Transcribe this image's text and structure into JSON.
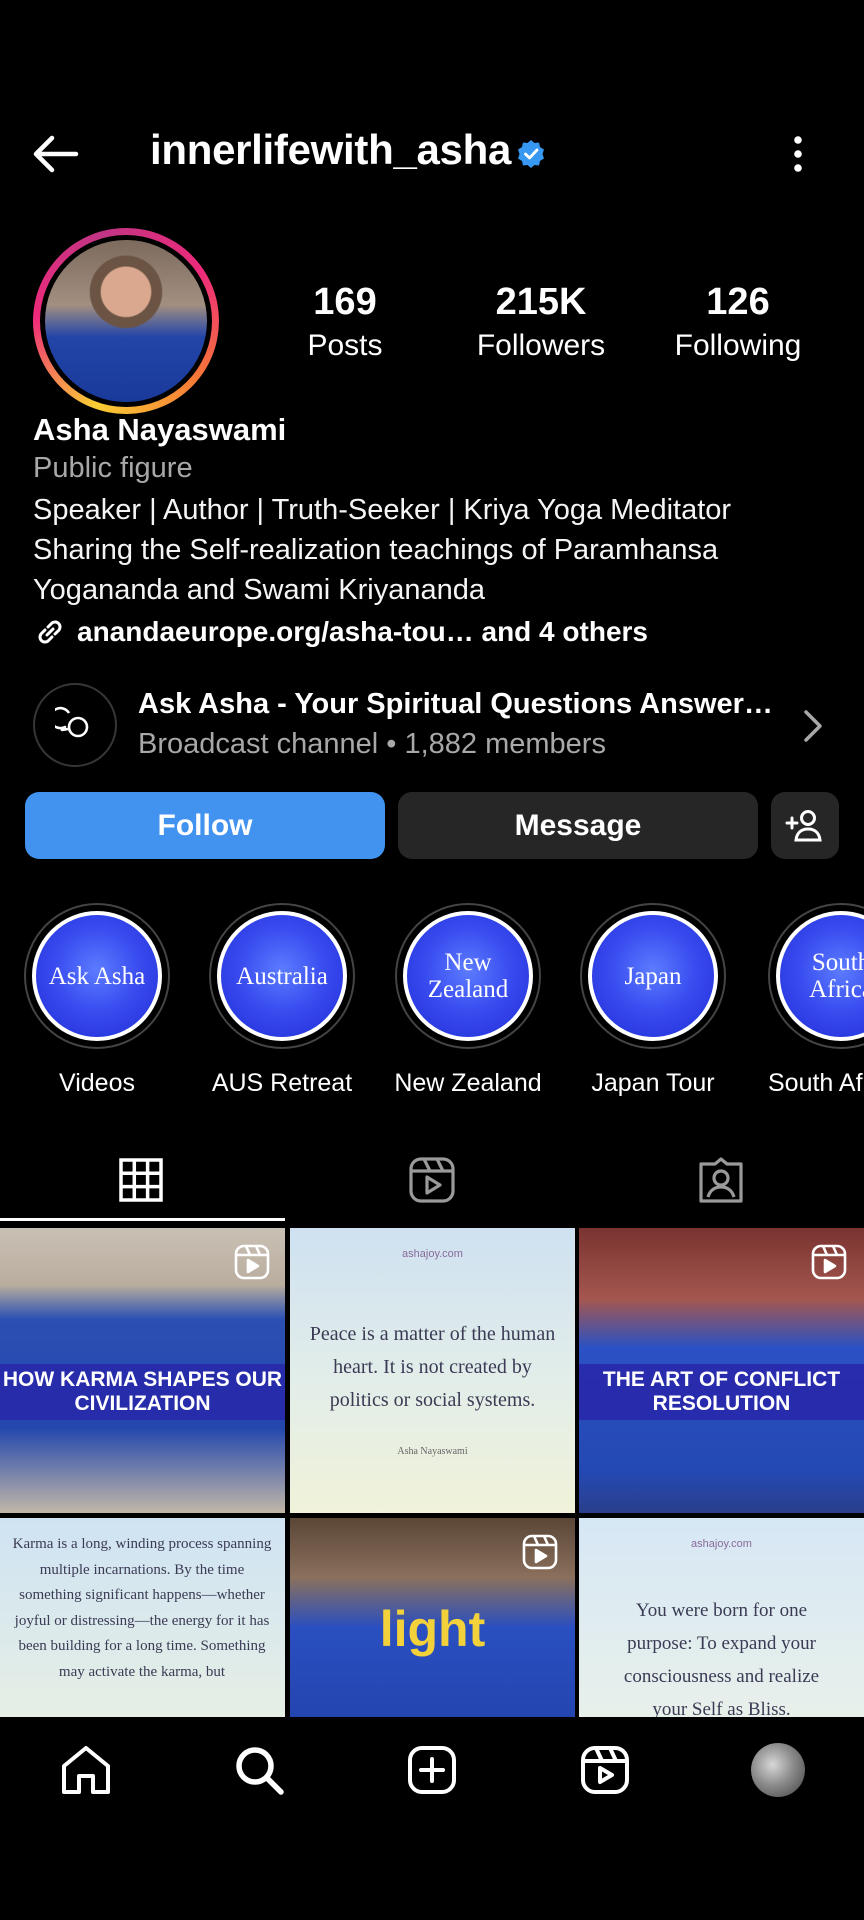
{
  "header": {
    "username": "innerlifewith_asha",
    "verified_icon": "verified-badge-icon",
    "back_icon": "arrow-left-icon",
    "more_icon": "more-vertical-icon"
  },
  "stats": {
    "posts_count": "169",
    "posts_label": "Posts",
    "followers_count": "215K",
    "followers_label": "Followers",
    "following_count": "126",
    "following_label": "Following"
  },
  "profile": {
    "name": "Asha Nayaswami",
    "category": "Public figure",
    "bio_lines": [
      "Speaker | Author | Truth-Seeker | Kriya Yoga Meditator",
      "Sharing the Self-realization teachings of Paramhansa",
      "Yogananda and Swami Kriyananda"
    ],
    "link": "anandaeurope.org/asha-tou… and 4 others"
  },
  "broadcast": {
    "title": "Ask Asha - Your Spiritual Questions Answer…",
    "subtitle": "Broadcast channel • 1,882 members"
  },
  "actions": {
    "follow": "Follow",
    "message": "Message"
  },
  "highlights": [
    {
      "cover": "Ask Asha",
      "label": "Videos"
    },
    {
      "cover": "Australia",
      "label": "AUS Retreat"
    },
    {
      "cover": "New Zealand",
      "label": "New Zealand"
    },
    {
      "cover": "Japan",
      "label": "Japan Tour"
    },
    {
      "cover": "South Africa",
      "label": "South Af"
    }
  ],
  "posts": {
    "p1_title": "HOW KARMA SHAPES OUR CIVILIZATION",
    "p2_site": "ashajoy.com",
    "p2_quote": "Peace is a matter of the human heart. It is not created by politics or social systems.",
    "p2_author": "Asha Nayaswami",
    "p3_title": "THE ART OF CONFLICT RESOLUTION",
    "p4_quote": "Karma is a long, winding process spanning multiple incarnations. By the time something significant happens—whether joyful or distressing—the energy for it has been building for a long time. Something may activate the karma, but",
    "p5_word": "light",
    "p6_site": "ashajoy.com",
    "p6_quote": "You were born for one purpose: To expand your consciousness and realize your Self as Bliss."
  },
  "colors": {
    "background": "#000000",
    "follow_button": "#4193ef",
    "secondary_button": "#262626",
    "muted_text": "#a8a8a8",
    "verified": "#3897f0",
    "highlight_blue": "#3a4df0"
  }
}
